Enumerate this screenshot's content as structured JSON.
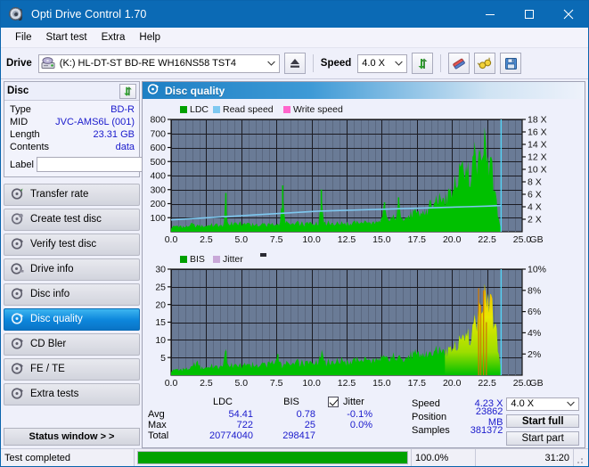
{
  "window": {
    "title": "Opti Drive Control 1.70",
    "icon": "disc-icon",
    "minimize": "minimize-icon",
    "maximize": "maximize-icon",
    "close": "close-icon"
  },
  "menu": [
    {
      "label": "File"
    },
    {
      "label": "Start test"
    },
    {
      "label": "Extra"
    },
    {
      "label": "Help"
    }
  ],
  "toolbar": {
    "drive_label": "Drive",
    "drive_value": "(K:)  HL-DT-ST BD-RE  WH16NS58 TST4",
    "eject_icon": "eject-icon",
    "speed_label": "Speed",
    "speed_value": "4.0 X",
    "refresh_icon": "refresh-icon",
    "eraser_icon": "eraser-icon",
    "glasses_icon": "glasses-icon",
    "save_icon": "save-icon"
  },
  "disc": {
    "header": "Disc",
    "refresh_icon": "refresh-icon",
    "rows": [
      {
        "key": "Type",
        "value": "BD-R"
      },
      {
        "key": "MID",
        "value": "JVC-AMS6L (001)"
      },
      {
        "key": "Length",
        "value": "23.31 GB"
      },
      {
        "key": "Contents",
        "value": "data"
      }
    ],
    "label_key": "Label",
    "label_value": "",
    "label_placeholder": "",
    "label_button_icon": "disc-label-icon"
  },
  "sidebar": {
    "items": [
      {
        "label": "Transfer rate",
        "icon": "disc-test-icon",
        "active": false
      },
      {
        "label": "Create test disc",
        "icon": "disc-burn-icon",
        "active": false
      },
      {
        "label": "Verify test disc",
        "icon": "disc-verify-icon",
        "active": false
      },
      {
        "label": "Drive info",
        "icon": "drive-info-icon",
        "active": false
      },
      {
        "label": "Disc info",
        "icon": "disc-info-icon",
        "active": false
      },
      {
        "label": "Disc quality",
        "icon": "disc-quality-icon",
        "active": true
      },
      {
        "label": "CD Bler",
        "icon": "cd-bler-icon",
        "active": false
      },
      {
        "label": "FE / TE",
        "icon": "fe-te-icon",
        "active": false
      },
      {
        "label": "Extra tests",
        "icon": "extra-tests-icon",
        "active": false
      }
    ],
    "status_window": "Status window > >"
  },
  "panel": {
    "title": "Disc quality",
    "icon": "disc-quality-icon"
  },
  "stats": {
    "columns": [
      "LDC",
      "BIS"
    ],
    "jitter_label": "Jitter",
    "jitter_checked": true,
    "rows": [
      {
        "label": "Avg",
        "ldc": "54.41",
        "bis": "0.78",
        "jitter": "-0.1%"
      },
      {
        "label": "Max",
        "ldc": "722",
        "bis": "25",
        "jitter": "0.0%"
      },
      {
        "label": "Total",
        "ldc": "20774040",
        "bis": "298417",
        "jitter": ""
      }
    ],
    "speed_key": "Speed",
    "speed_value": "4.23 X",
    "position_key": "Position",
    "position_value": "23862 MB",
    "samples_key": "Samples",
    "samples_value": "381372",
    "select_speed": "4.0 X",
    "start_full": "Start full",
    "start_part": "Start part"
  },
  "statusbar": {
    "message": "Test completed",
    "progress_pct": 100.0,
    "progress_text": "100.0%",
    "elapsed": "31:20"
  },
  "colors": {
    "accent": "#0b6ab5",
    "plot_bg": "#6a7b96",
    "ldc_green": "#00c000",
    "read_speed": "#7ec8f0",
    "write_speed": "#ff66cc",
    "jitter": "#c9a8d8",
    "value_blue": "#1a1acc",
    "progress_green": "#00a200"
  },
  "chart_data": [
    {
      "type": "area",
      "name": "ldc-chart",
      "title": "",
      "xlabel": "GB",
      "ylabel": "",
      "xlim": [
        0,
        25
      ],
      "ylim": [
        0,
        800
      ],
      "y2lim": [
        0,
        18
      ],
      "grid": true,
      "legend_position": "top-left",
      "legend": [
        {
          "label": "LDC",
          "color": "#00a000"
        },
        {
          "label": "Read speed",
          "color": "#7ec8f0"
        },
        {
          "label": "Write speed",
          "color": "#ff66cc"
        }
      ],
      "xticks": [
        "0.0",
        "2.5",
        "5.0",
        "7.5",
        "10.0",
        "12.5",
        "15.0",
        "17.5",
        "20.0",
        "22.5",
        "25.0"
      ],
      "yticks": [
        "100",
        "200",
        "300",
        "400",
        "500",
        "600",
        "700",
        "800"
      ],
      "y2ticks": [
        "2 X",
        "4 X",
        "6 X",
        "8 X",
        "10 X",
        "12 X",
        "14 X",
        "16 X",
        "18 X"
      ],
      "data_end_x": 23.5,
      "cursor_x": 23.5,
      "series": [
        {
          "name": "LDC",
          "color": "#00c000",
          "x": [
            0.0,
            0.25,
            0.5,
            0.75,
            1.0,
            1.25,
            1.5,
            1.75,
            2.0,
            2.25,
            2.5,
            2.75,
            3.0,
            3.25,
            3.5,
            3.75,
            3.9,
            4.0,
            4.25,
            4.5,
            4.75,
            5.0,
            5.25,
            5.5,
            5.75,
            6.0,
            6.25,
            6.5,
            6.75,
            7.0,
            7.25,
            7.5,
            7.75,
            7.95,
            8.1,
            8.25,
            8.5,
            8.75,
            9.0,
            9.25,
            9.5,
            9.75,
            10.0,
            10.25,
            10.5,
            10.7,
            10.85,
            11.0,
            11.25,
            11.5,
            11.75,
            12.0,
            12.25,
            12.5,
            12.75,
            13.0,
            13.25,
            13.5,
            13.75,
            14.0,
            14.25,
            14.5,
            14.75,
            15.0,
            15.2,
            15.35,
            15.5,
            15.75,
            16.0,
            16.2,
            16.35,
            16.5,
            16.75,
            17.0,
            17.25,
            17.5,
            17.75,
            18.0,
            18.25,
            18.45,
            18.6,
            18.8,
            19.0,
            19.25,
            19.5,
            19.75,
            20.0,
            20.25,
            20.5,
            20.7,
            20.85,
            21.0,
            21.25,
            21.5,
            21.7,
            21.85,
            22.0,
            22.2,
            22.4,
            22.55,
            22.7,
            22.85,
            23.0,
            23.2,
            23.35,
            23.5
          ],
          "y": [
            30,
            45,
            38,
            42,
            36,
            40,
            55,
            48,
            44,
            50,
            46,
            52,
            48,
            56,
            50,
            60,
            275,
            62,
            58,
            66,
            60,
            64,
            58,
            62,
            56,
            60,
            54,
            58,
            52,
            56,
            50,
            54,
            58,
            330,
            70,
            66,
            62,
            58,
            62,
            60,
            58,
            62,
            64,
            60,
            68,
            300,
            80,
            70,
            66,
            62,
            60,
            64,
            62,
            66,
            64,
            68,
            66,
            70,
            68,
            72,
            70,
            74,
            78,
            82,
            210,
            100,
            95,
            105,
            100,
            245,
            120,
            115,
            110,
            125,
            130,
            140,
            135,
            150,
            160,
            230,
            200,
            215,
            230,
            250,
            270,
            300,
            330,
            380,
            420,
            520,
            430,
            460,
            500,
            560,
            620,
            520,
            580,
            700,
            620,
            560,
            520,
            480,
            380,
            200,
            90,
            20
          ]
        },
        {
          "name": "Read speed",
          "color": "#7ec8f0",
          "x": [
            0.0,
            1.5,
            3.0,
            4.5,
            6.0,
            7.5,
            9.0,
            10.5,
            12.0,
            13.5,
            15.0,
            16.5,
            18.0,
            19.5,
            21.0,
            22.5,
            23.5
          ],
          "y": [
            1.9,
            2.1,
            2.3,
            2.5,
            2.7,
            2.9,
            3.1,
            3.3,
            3.4,
            3.5,
            3.6,
            3.7,
            3.8,
            3.9,
            4.0,
            4.1,
            4.2
          ]
        }
      ]
    },
    {
      "type": "area",
      "name": "bis-jitter-chart",
      "title": "",
      "xlabel": "GB",
      "ylabel": "",
      "xlim": [
        0,
        25
      ],
      "ylim": [
        0,
        30
      ],
      "y2lim": [
        0,
        10
      ],
      "grid": true,
      "legend_position": "top-left",
      "legend": [
        {
          "label": "BIS",
          "color": "#00a000"
        },
        {
          "label": "Jitter",
          "color": "#c9a8d8"
        }
      ],
      "xticks": [
        "0.0",
        "2.5",
        "5.0",
        "7.5",
        "10.0",
        "12.5",
        "15.0",
        "17.5",
        "20.0",
        "22.5",
        "25.0"
      ],
      "yticks": [
        "5",
        "10",
        "15",
        "20",
        "25",
        "30"
      ],
      "y2ticks": [
        "2%",
        "4%",
        "6%",
        "8%",
        "10%"
      ],
      "data_end_x": 23.5,
      "cursor_x": 23.5,
      "series": [
        {
          "name": "BIS",
          "color": "#00c000",
          "x": [
            0.0,
            0.3,
            0.6,
            0.9,
            1.2,
            1.5,
            1.8,
            1.95,
            2.1,
            2.4,
            2.7,
            3.0,
            3.3,
            3.6,
            3.9,
            4.0,
            4.3,
            4.6,
            4.9,
            5.2,
            5.5,
            5.8,
            6.1,
            6.4,
            6.7,
            7.0,
            7.3,
            7.6,
            7.8,
            8.0,
            8.3,
            8.6,
            8.9,
            9.2,
            9.5,
            9.8,
            10.1,
            10.4,
            10.7,
            10.85,
            11.0,
            11.3,
            11.6,
            11.9,
            12.2,
            12.5,
            12.8,
            13.1,
            13.4,
            13.7,
            14.0,
            14.3,
            14.6,
            14.9,
            15.2,
            15.5,
            15.8,
            16.1,
            16.4,
            16.7,
            17.0,
            17.3,
            17.6,
            17.9,
            18.2,
            18.5,
            18.8,
            19.1,
            19.4,
            19.7,
            20.0,
            20.3,
            20.6,
            20.9,
            21.2,
            21.5,
            21.8,
            22.0,
            22.2,
            22.4,
            22.6,
            22.8,
            23.0,
            23.2,
            23.35,
            23.5
          ],
          "y": [
            1.2,
            1.8,
            1.5,
            2.0,
            1.7,
            2.2,
            4.4,
            3.0,
            2.3,
            2.6,
            2.4,
            2.8,
            2.5,
            3.0,
            6.8,
            3.2,
            2.9,
            3.1,
            2.8,
            3.3,
            3.0,
            3.4,
            3.1,
            3.5,
            3.2,
            3.6,
            3.3,
            5.9,
            3.5,
            3.2,
            3.6,
            3.3,
            3.8,
            3.4,
            3.9,
            3.5,
            4.0,
            3.7,
            8.1,
            5.2,
            4.1,
            3.8,
            4.2,
            4.0,
            4.4,
            4.1,
            4.5,
            4.2,
            4.6,
            4.3,
            4.8,
            4.5,
            5.0,
            4.7,
            5.2,
            4.9,
            5.4,
            5.1,
            5.6,
            5.3,
            6.0,
            5.6,
            6.4,
            6.0,
            6.8,
            6.4,
            7.2,
            7.0,
            8.0,
            7.6,
            9.0,
            8.5,
            10.5,
            11.5,
            13.0,
            15.0,
            17.5,
            20.5,
            23.5,
            22.0,
            24.5,
            21.0,
            18.0,
            12.0,
            6.0,
            1.5
          ]
        }
      ]
    }
  ]
}
